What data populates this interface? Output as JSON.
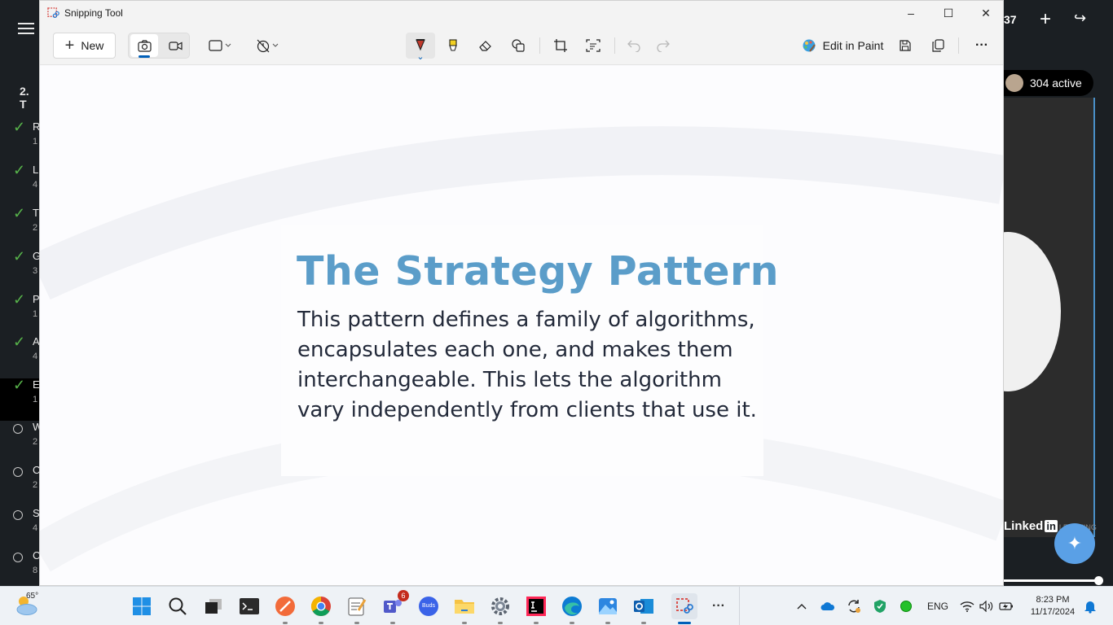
{
  "background_app": {
    "section_title": "2. T",
    "list_items": [
      {
        "initial": "R",
        "sub": "1",
        "done": true,
        "active": false
      },
      {
        "initial": "L",
        "sub": "4",
        "done": true,
        "active": false
      },
      {
        "initial": "T",
        "sub": "2",
        "done": true,
        "active": false
      },
      {
        "initial": "G",
        "sub": "3",
        "done": true,
        "active": false
      },
      {
        "initial": "P",
        "sub": "1",
        "done": true,
        "active": false
      },
      {
        "initial": "A",
        "sub": "4",
        "done": true,
        "active": false
      },
      {
        "initial": "E",
        "sub": "1",
        "done": true,
        "active": true
      },
      {
        "initial": "W",
        "sub": "2",
        "done": false,
        "active": false
      },
      {
        "initial": "C",
        "sub": "2",
        "done": false,
        "active": false
      },
      {
        "initial": "S",
        "sub": "4",
        "done": false,
        "active": false
      },
      {
        "initial": "C",
        "sub": "8",
        "done": false,
        "active": false
      }
    ],
    "top_right_count": "37",
    "active_count": "304 active",
    "brand": "Linked",
    "brand_box": "in",
    "brand_suffix": "LEARNING",
    "accent_color": "#57b34a"
  },
  "window": {
    "title": "Snipping Tool",
    "minimize_label": "–",
    "maximize_label": "☐",
    "close_label": "✕"
  },
  "toolbar": {
    "new_label": "New",
    "edit_in_paint_label": "Edit in Paint",
    "more_label": "···"
  },
  "slide": {
    "title": "The Strategy Pattern",
    "body": "This pattern defines a family of algorithms, encapsulates each one, and makes them interchangeable. This lets the algorithm vary independently from clients that use it.",
    "title_color": "#5b9dc9"
  },
  "taskbar": {
    "temperature": "65°",
    "teams_badge": "6",
    "buds_label": "Buds",
    "more_label": "···",
    "language": "ENG",
    "time": "8:23 PM",
    "date": "11/17/2024"
  }
}
